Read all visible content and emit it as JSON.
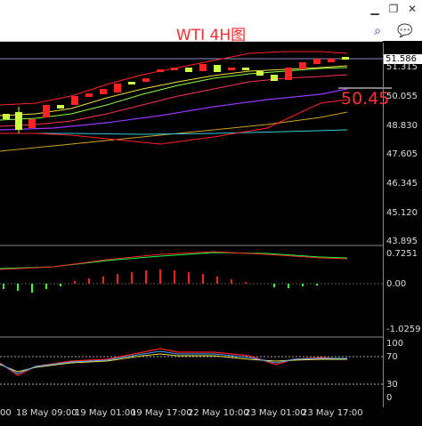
{
  "window": {
    "min_icon": "minimize-icon",
    "max_icon": "restore-icon",
    "close_icon": "close-icon"
  },
  "header": {
    "title": "WTI 4H图",
    "search_icon": "search-icon",
    "chat_icon": "chat-icon"
  },
  "price_pane": {
    "current_price_box": "51.586",
    "big_price": "50.45",
    "y_labels": [
      "51.315",
      "50.055",
      "48.830",
      "47.605",
      "46.345",
      "45.120",
      "43.895"
    ]
  },
  "macd_pane": {
    "y_labels": [
      "0.7251",
      "0.00",
      "-1.0259"
    ]
  },
  "rsi_pane": {
    "y_labels": [
      "100",
      "70",
      "30",
      "0"
    ]
  },
  "x_axis": {
    "labels": [
      "00",
      "18 May 09:00",
      "19 May 01:00",
      "19 May 17:00",
      "22 May 10:00",
      "23 May 01:00",
      "23 May 17:00"
    ]
  },
  "colors": {
    "title": "#ff2a2a",
    "bull": "#ccff44",
    "bear": "#ff2222"
  }
}
